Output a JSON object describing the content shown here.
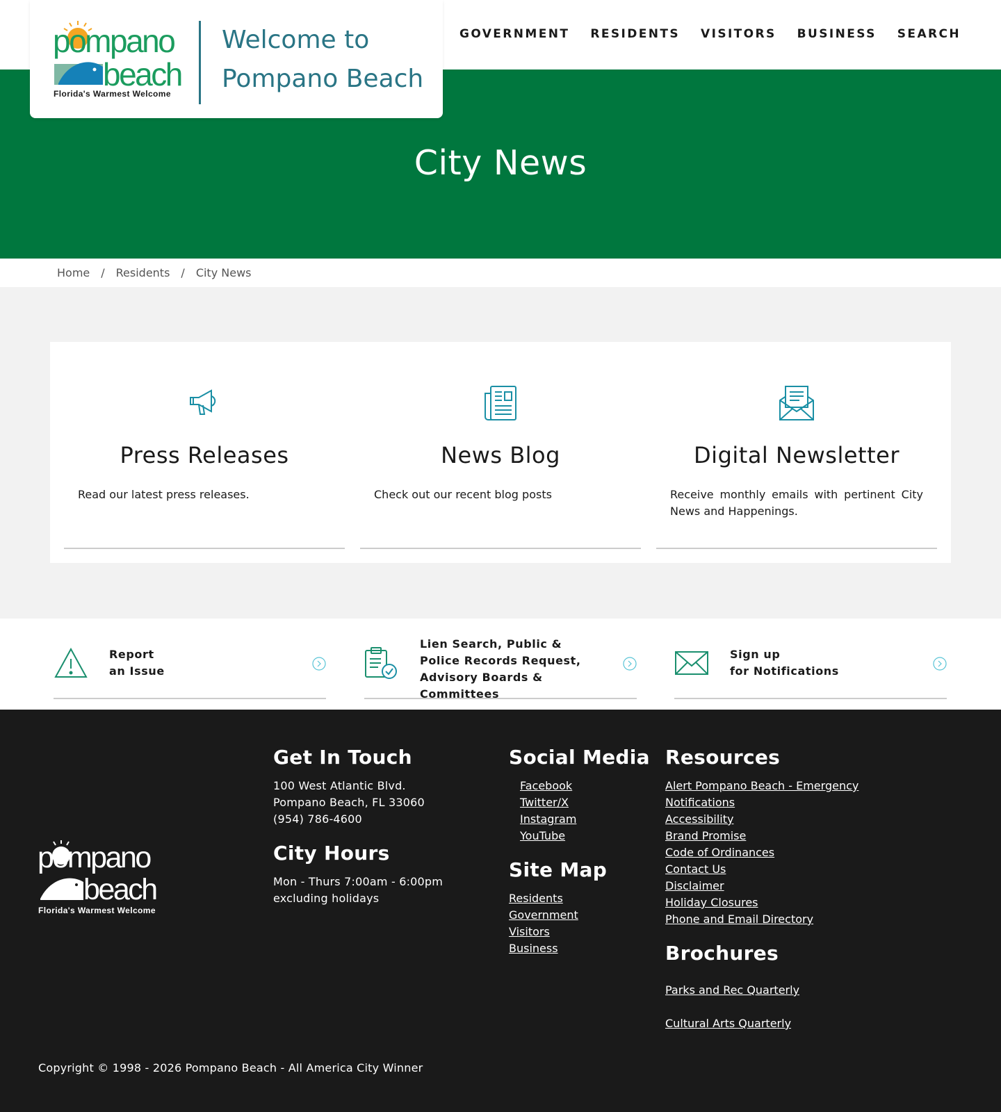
{
  "brand": {
    "logo_word_1": "pompano",
    "logo_word_2": "beach",
    "logo_tagline": "Florida's Warmest Welcome",
    "welcome_line_1": "Welcome to",
    "welcome_line_2": "Pompano Beach",
    "colors": {
      "green": "#00773e",
      "teal": "#2a7585",
      "sun": "#f5a623",
      "logo_green": "#1b9c5e"
    }
  },
  "nav": {
    "items": [
      {
        "label": "GOVERNMENT"
      },
      {
        "label": "RESIDENTS"
      },
      {
        "label": "VISITORS"
      },
      {
        "label": "BUSINESS"
      },
      {
        "label": "SEARCH"
      }
    ]
  },
  "hero": {
    "title": "City News"
  },
  "breadcrumb": {
    "items": [
      "Home",
      "Residents",
      "City News"
    ],
    "separator": "/"
  },
  "cards": [
    {
      "icon": "megaphone-icon",
      "title": "Press Releases",
      "description": "Read our latest press releases."
    },
    {
      "icon": "newspaper-icon",
      "title": "News Blog",
      "description": "Check out our recent blog posts"
    },
    {
      "icon": "envelope-letter-icon",
      "title": "Digital Newsletter",
      "description": "Receive monthly emails with pertinent City News and Happenings."
    }
  ],
  "quick_links": [
    {
      "icon": "warning-icon",
      "label_line_1": "Report",
      "label_line_2": "an Issue"
    },
    {
      "icon": "clipboard-check-icon",
      "label": "Lien Search, Public & Police Records Request, Advisory Boards & Committees"
    },
    {
      "icon": "mail-icon",
      "label_line_1": "Sign up",
      "label_line_2": "for Notifications"
    }
  ],
  "footer": {
    "get_in_touch": {
      "heading": "Get In Touch",
      "address_1": "100 West Atlantic Blvd.",
      "address_2": "Pompano Beach, FL 33060",
      "phone": "(954) 786-4600"
    },
    "city_hours": {
      "heading": "City Hours",
      "hours": "Mon - Thurs 7:00am - 6:00pm",
      "note": "excluding holidays"
    },
    "social_media": {
      "heading": "Social Media",
      "links": [
        "Facebook",
        "Twitter/X",
        "Instagram",
        "YouTube"
      ]
    },
    "site_map": {
      "heading": "Site Map",
      "links": [
        "Residents",
        "Government",
        "Visitors",
        "Business"
      ]
    },
    "resources": {
      "heading": "Resources",
      "links": [
        "Alert Pompano Beach - Emergency Notifications",
        "Accessibility",
        "Brand Promise",
        "Code of Ordinances",
        "Contact Us",
        "Disclaimer",
        "Holiday Closures",
        "Phone and Email Directory"
      ]
    },
    "brochures": {
      "heading": "Brochures",
      "links": [
        "Parks and Rec Quarterly",
        "Cultural Arts Quarterly"
      ]
    },
    "copyright": "Copyright © 1998 - 2026 Pompano Beach - All America City Winner"
  }
}
